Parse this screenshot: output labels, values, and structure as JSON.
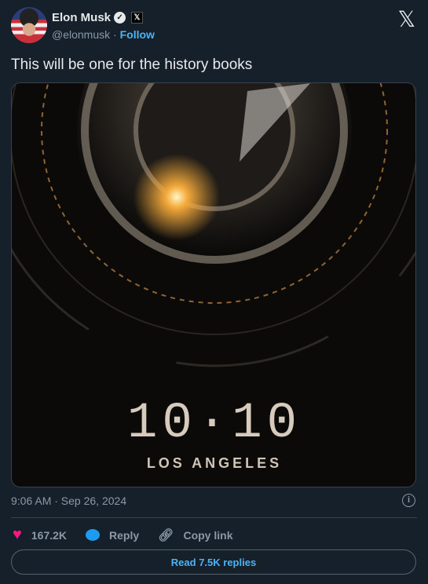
{
  "author": {
    "name": "Elon Musk",
    "handle": "@elonmusk",
    "separator": "·",
    "follow_label": "Follow",
    "verified_icon": "verified-badge-icon",
    "affiliate_icon": "x-affiliate-icon"
  },
  "tweet": {
    "text": "This will be one for the history books",
    "timestamp": "9:06 AM · Sep 26, 2024"
  },
  "media": {
    "headline": "10·10",
    "subline": "LOS ANGELES"
  },
  "actions": {
    "likes": "167.2K",
    "reply_label": "Reply",
    "copy_label": "Copy link"
  },
  "read_replies_label": "Read 7.5K replies",
  "colors": {
    "background": "#15202b",
    "accent": "#1d9bf0",
    "like": "#f91880"
  }
}
